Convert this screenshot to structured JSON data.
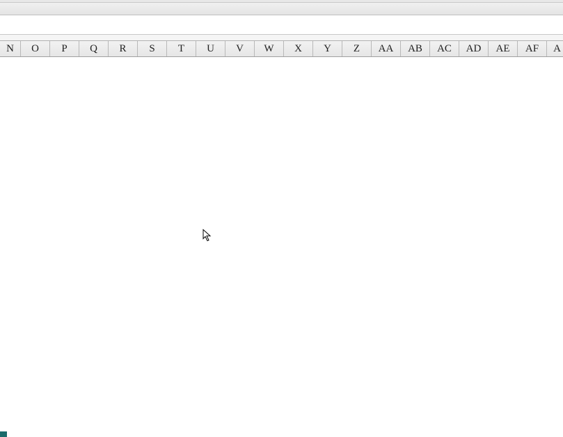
{
  "columns": [
    "N",
    "O",
    "P",
    "Q",
    "R",
    "S",
    "T",
    "U",
    "V",
    "W",
    "X",
    "Y",
    "Z",
    "AA",
    "AB",
    "AC",
    "AD",
    "AE",
    "AF",
    "A"
  ],
  "colors": {
    "header_bg_top": "#f2f2f2",
    "header_bg_bottom": "#e6e6e6",
    "border": "#b8b8b8",
    "text": "#202020",
    "accent": "#1a6b6b"
  }
}
